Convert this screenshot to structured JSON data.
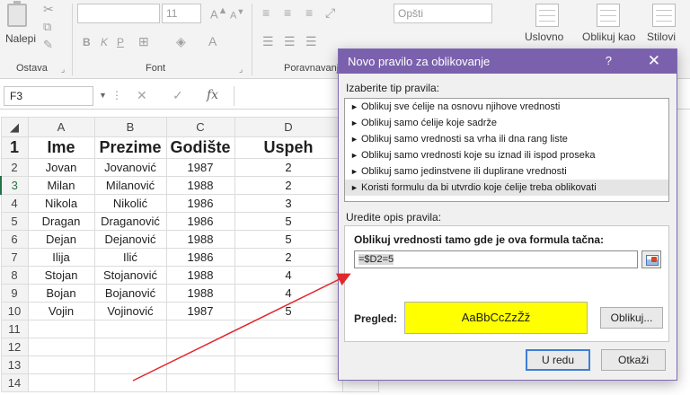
{
  "ribbon": {
    "paste_label": "Nalepi",
    "clipboard_group": "Ostava",
    "font_name": "",
    "font_size": "11",
    "font_group": "Font",
    "bold": "B",
    "italic": "K",
    "underline": "P",
    "alignment_group": "Poravnavanje",
    "number_format": "Opšti",
    "conditional_label": "Uslovno",
    "table_label": "Oblikuj kao",
    "styles_label": "Stilovi",
    "launcher_glyph": "⌟"
  },
  "formula_bar": {
    "name_box": "F3",
    "cancel_glyph": "✕",
    "enter_glyph": "✓",
    "fx_glyph": "fx"
  },
  "sheet": {
    "columns": [
      "A",
      "B",
      "C",
      "D"
    ],
    "header": [
      "Ime",
      "Prezime",
      "Godište",
      "Uspeh"
    ],
    "rows": [
      [
        "Jovan",
        "Jovanović",
        "1987",
        "2"
      ],
      [
        "Milan",
        "Milanović",
        "1988",
        "2"
      ],
      [
        "Nikola",
        "Nikolić",
        "1986",
        "3"
      ],
      [
        "Dragan",
        "Draganović",
        "1986",
        "5"
      ],
      [
        "Dejan",
        "Dejanović",
        "1988",
        "5"
      ],
      [
        "Ilija",
        "Ilić",
        "1986",
        "2"
      ],
      [
        "Stojan",
        "Stojanović",
        "1988",
        "4"
      ],
      [
        "Bojan",
        "Bojanović",
        "1988",
        "4"
      ],
      [
        "Vojin",
        "Vojinović",
        "1987",
        "5"
      ]
    ],
    "row_numbers": [
      "1",
      "2",
      "3",
      "4",
      "5",
      "6",
      "7",
      "8",
      "9",
      "10",
      "11",
      "12",
      "13",
      "14"
    ]
  },
  "dialog": {
    "title": "Novo pravilo za oblikovanje",
    "help": "?",
    "close": "✕",
    "select_type_label": "Izaberite tip pravila:",
    "rule_types": [
      "Oblikuj sve ćelije na osnovu njihove vrednosti",
      "Oblikuj samo ćelije koje sadrže",
      "Oblikuj samo vrednosti sa vrha ili dna rang liste",
      "Oblikuj samo vrednosti koje su iznad ili ispod proseka",
      "Oblikuj samo jedinstvene ili duplirane vrednosti",
      "Koristi formulu da bi utvrdio koje ćelije treba oblikovati"
    ],
    "selected_index": 5,
    "edit_label": "Uredite opis pravila:",
    "formula_label": "Oblikuj vrednosti tamo gde je ova formula tačna:",
    "formula_value": "=$D2=5",
    "preview_label": "Pregled:",
    "preview_sample": "AaBbCcZzŽž",
    "format_button": "Oblikuj...",
    "ok_button": "U redu",
    "cancel_button": "Otkaži",
    "rule_arrow": "►"
  },
  "colors": {
    "title_bar": "#7b61ad",
    "preview_fill": "#ffff00",
    "highlight": "#e0282d"
  }
}
